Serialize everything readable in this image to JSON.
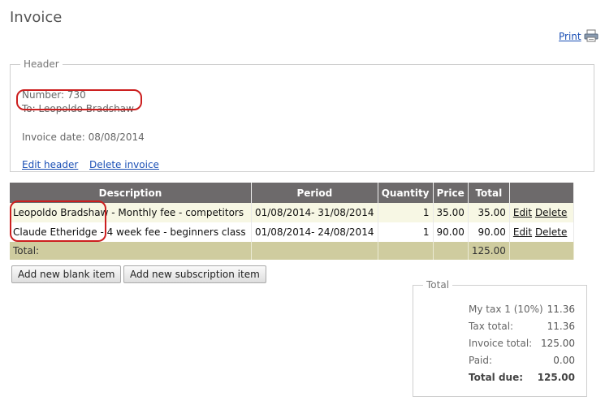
{
  "page": {
    "title": "Invoice",
    "print_label": "Print"
  },
  "header": {
    "legend": "Header",
    "number": "Number: 730",
    "to": "To: Leopoldo Bradshaw",
    "invoice_date": "Invoice date: 08/08/2014",
    "edit_link": "Edit header",
    "delete_link": "Delete invoice"
  },
  "items_table": {
    "columns": [
      "Description",
      "Period",
      "Quantity",
      "Price",
      "Total",
      ""
    ],
    "rows": [
      {
        "description": "Leopoldo Bradshaw - Monthly fee - competitors",
        "period": "01/08/2014- 31/08/2014",
        "quantity": "1",
        "price": "35.00",
        "total": "35.00",
        "edit": "Edit",
        "delete": "Delete"
      },
      {
        "description": "Claude Etheridge - 4 week fee - beginners class",
        "period": "01/08/2014- 24/08/2014",
        "quantity": "1",
        "price": "90.00",
        "total": "90.00",
        "edit": "Edit",
        "delete": "Delete"
      }
    ],
    "total_label": "Total:",
    "total_value": "125.00"
  },
  "buttons": {
    "add_blank": "Add new blank item",
    "add_subscription": "Add new subscription item"
  },
  "totals": {
    "legend": "Total",
    "lines": [
      {
        "label": "My tax 1 (10%)",
        "value": "11.36"
      },
      {
        "label": "Tax total:",
        "value": "11.36"
      },
      {
        "label": "Invoice total:",
        "value": "125.00"
      },
      {
        "label": "Paid:",
        "value": "0.00"
      },
      {
        "label": "Total due:",
        "value": "125.00"
      }
    ]
  },
  "colors": {
    "table_header_bg": "#6d6a6b",
    "row_highlight_bg": "#f7f7e4",
    "total_row_bg": "#cfcc9f",
    "link": "#1a4fb5",
    "annotation_ring": "#cc1f1f"
  },
  "icons": {
    "print": "printer-icon"
  }
}
